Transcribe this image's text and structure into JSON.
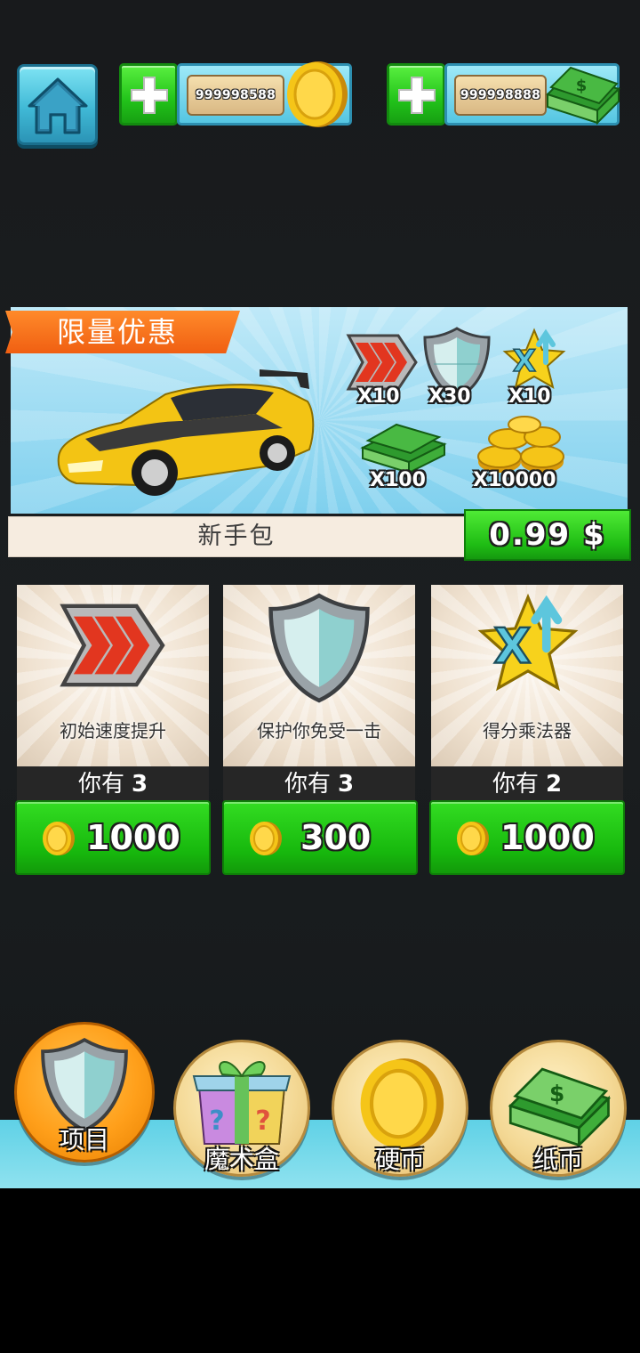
{
  "currency": {
    "coins": "999998588",
    "cash": "999998888"
  },
  "banner": {
    "ribbon_title": "限量优惠",
    "items": [
      {
        "icon": "speed-boost-icon",
        "qty": "X10"
      },
      {
        "icon": "shield-icon",
        "qty": "X30"
      },
      {
        "icon": "multiplier-icon",
        "qty": "X10"
      },
      {
        "icon": "cash-stack-icon",
        "qty": "X100"
      },
      {
        "icon": "coin-pile-icon",
        "qty": "X10000"
      }
    ],
    "pack_name": "新手包",
    "price": "0.99 $"
  },
  "cards": [
    {
      "icon": "speed-boost-icon",
      "label": "初始速度提升",
      "have_label": "你有",
      "have_count": "3",
      "price": "1000"
    },
    {
      "icon": "shield-icon",
      "label": "保护你免受一击",
      "have_label": "你有",
      "have_count": "3",
      "price": "300"
    },
    {
      "icon": "multiplier-icon",
      "label": "得分乘法器",
      "have_label": "你有",
      "have_count": "2",
      "price": "1000"
    }
  ],
  "tabs": [
    {
      "label": "项目",
      "icon": "shield-icon",
      "active": true
    },
    {
      "label": "魔术盒",
      "icon": "gift-box-icon",
      "active": false
    },
    {
      "label": "硬币",
      "icon": "coin-icon",
      "active": false
    },
    {
      "label": "纸币",
      "icon": "cash-stack-icon",
      "active": false
    }
  ],
  "colors": {
    "accent_green": "#22c31a",
    "accent_orange": "#f05f12",
    "panel_blue": "#55c6e2",
    "active_tab": "#ff9f1a"
  }
}
